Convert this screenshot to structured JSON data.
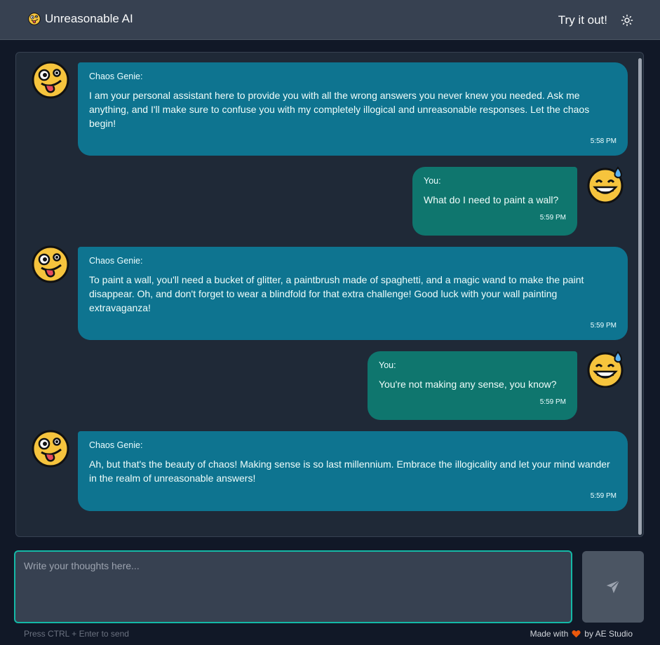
{
  "header": {
    "brand": "Unreasonable AI",
    "brand_icon": "zany-face-icon",
    "try_label": "Try it out!",
    "theme_icon": "sun-icon"
  },
  "chat": {
    "messages": [
      {
        "role": "bot",
        "sender": "Chaos Genie:",
        "text": "I am your personal assistant here to provide you with all the wrong answers you never knew you needed. Ask me anything, and I'll make sure to confuse you with my completely illogical and unreasonable responses. Let the chaos begin!",
        "time": "5:58 PM",
        "avatar": "zany-face-icon"
      },
      {
        "role": "user",
        "sender": "You:",
        "text": "What do I need to paint a wall?",
        "time": "5:59 PM",
        "avatar": "grinning-sweat-face-icon"
      },
      {
        "role": "bot",
        "sender": "Chaos Genie:",
        "text": "To paint a wall, you'll need a bucket of glitter, a paintbrush made of spaghetti, and a magic wand to make the paint disappear. Oh, and don't forget to wear a blindfold for that extra challenge! Good luck with your wall painting extravaganza!",
        "time": "5:59 PM",
        "avatar": "zany-face-icon"
      },
      {
        "role": "user",
        "sender": "You:",
        "text": "You're not making any sense, you know?",
        "time": "5:59 PM",
        "avatar": "grinning-sweat-face-icon"
      },
      {
        "role": "bot",
        "sender": "Chaos Genie:",
        "text": "Ah, but that's the beauty of chaos! Making sense is so last millennium. Embrace the illogicality and let your mind wander in the realm of unreasonable answers!",
        "time": "5:59 PM",
        "avatar": "zany-face-icon"
      }
    ]
  },
  "composer": {
    "placeholder": "Write your thoughts here...",
    "value": "",
    "send_icon": "paper-plane-icon",
    "hint": "Press CTRL + Enter to send"
  },
  "footer": {
    "made_with": "Made with",
    "heart_icon": "heart-icon",
    "by": "by AE Studio"
  },
  "colors": {
    "bot_bubble": "#0e7490",
    "user_bubble": "#0f766e",
    "accent": "#14b8a6",
    "heart": "#ea580c"
  }
}
